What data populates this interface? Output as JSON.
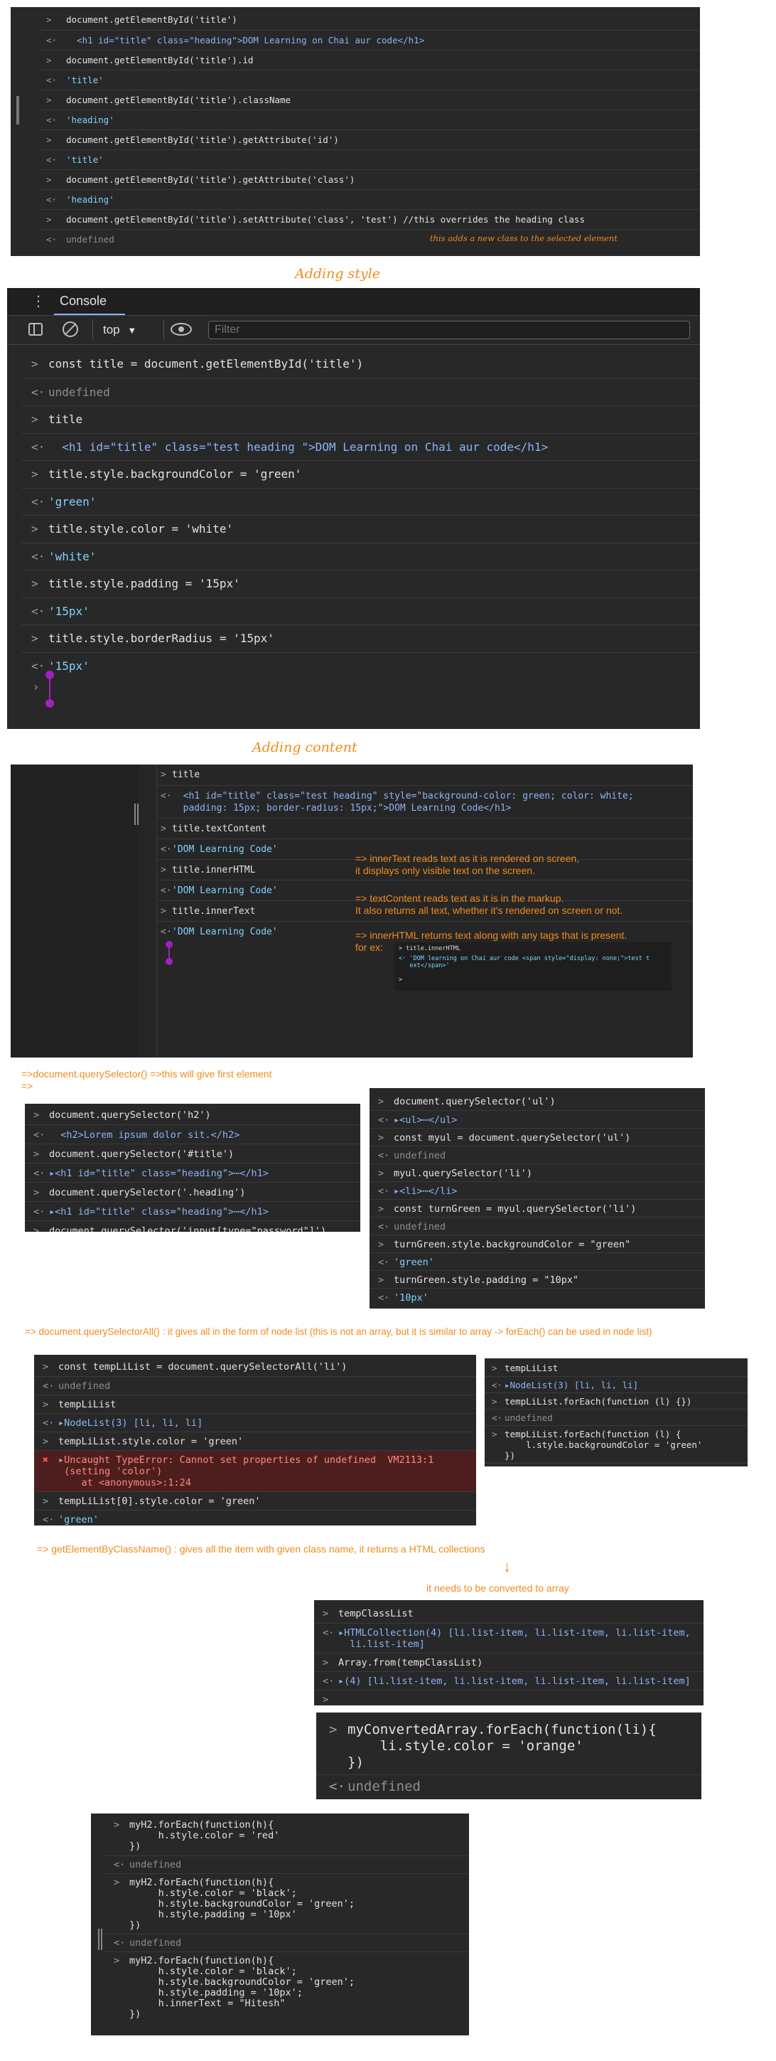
{
  "panel1": {
    "rows": [
      {
        "pr": ">",
        "code": "document.getElementById('title')"
      },
      {
        "pr": "<·",
        "code": "  <h1 id=\"title\" class=\"heading\">DOM Learning on Chai aur code</h1>"
      },
      {
        "pr": ">",
        "code": "document.getElementById('title').id"
      },
      {
        "pr": "<·",
        "code": "'title'"
      },
      {
        "pr": ">",
        "code": "document.getElementById('title').className"
      },
      {
        "pr": "<·",
        "code": "'heading'"
      },
      {
        "pr": ">",
        "code": "document.getElementById('title').getAttribute('id')"
      },
      {
        "pr": "<·",
        "code": "'title'"
      },
      {
        "pr": ">",
        "code": "document.getElementById('title').getAttribute('class')"
      },
      {
        "pr": "<·",
        "code": "'heading'"
      },
      {
        "pr": ">",
        "code": "document.getElementById('title').setAttribute('class', 'test') //this overrides the heading class"
      },
      {
        "pr": "<·",
        "code": "undefined"
      }
    ],
    "annotation": "this adds a new class to the selected element"
  },
  "heading_adding_style": "Adding style",
  "console": {
    "tab_label": "Console",
    "context": "top",
    "filter_placeholder": "Filter",
    "rows": [
      {
        "pr": ">",
        "code": "const title = document.getElementById('title')"
      },
      {
        "pr": "<·",
        "code": "undefined"
      },
      {
        "pr": ">",
        "code": "title"
      },
      {
        "pr": "<·",
        "code": "  <h1 id=\"title\" class=\"test heading \">DOM Learning on Chai aur code</h1>"
      },
      {
        "pr": ">",
        "code": "title.style.backgroundColor = 'green'"
      },
      {
        "pr": "<·",
        "code": "'green'"
      },
      {
        "pr": ">",
        "code": "title.style.color = 'white'"
      },
      {
        "pr": "<·",
        "code": "'white'"
      },
      {
        "pr": ">",
        "code": "title.style.padding = '15px'"
      },
      {
        "pr": "<·",
        "code": "'15px'"
      },
      {
        "pr": ">",
        "code": "title.style.borderRadius = '15px'"
      },
      {
        "pr": "<·",
        "code": "'15px'"
      }
    ]
  },
  "heading_adding_content": "Adding content",
  "panel3": {
    "rows": [
      {
        "pr": ">",
        "code": "title"
      },
      {
        "pr": "<·",
        "code": "  <h1 id=\"title\" class=\"test heading\" style=\"background-color: green; color: white;\n  padding: 15px; border-radius: 15px;\">DOM Learning Code</h1>"
      },
      {
        "pr": ">",
        "code": "title.textContent"
      },
      {
        "pr": "<·",
        "code": "'DOM Learning Code'"
      },
      {
        "pr": ">",
        "code": "title.innerHTML"
      },
      {
        "pr": "<·",
        "code": "'DOM Learning Code'"
      },
      {
        "pr": ">",
        "code": "title.innerText"
      },
      {
        "pr": "<·",
        "code": "'DOM Learning Code'"
      }
    ],
    "notes": [
      "=> innerText reads text as it is rendered on screen,\nit displays only visible text on the screen.",
      "=> textContent reads text as it is in the markup.\nIt also returns all text, whether it's rendered on screen or not.",
      "=> innerHTML returns text along with any tags that is present.\nfor ex:"
    ],
    "mini": [
      "> title.innerHTML",
      "<· 'DOM learning on Chai aur code <span style=\"display: none;\">test t\n   ext</span>'",
      ">"
    ]
  },
  "qs_note": "=>document.querySelector() =>this will give first element\n=>",
  "panel4": {
    "rows": [
      {
        "pr": ">",
        "code": "document.querySelector('h2')"
      },
      {
        "pr": "<·",
        "code": "  <h2>Lorem ipsum dolor sit.</h2>"
      },
      {
        "pr": ">",
        "code": "document.querySelector('#title')"
      },
      {
        "pr": "<·",
        "code": "▸<h1 id=\"title\" class=\"heading\">⋯</h1>"
      },
      {
        "pr": ">",
        "code": "document.querySelector('.heading')"
      },
      {
        "pr": "<·",
        "code": "▸<h1 id=\"title\" class=\"heading\">⋯</h1>"
      },
      {
        "pr": ">",
        "code": "document.querySelector('input[type=\"password\"]')"
      }
    ]
  },
  "panel5": {
    "rows": [
      {
        "pr": ">",
        "code": "document.querySelector('ul')"
      },
      {
        "pr": "<·",
        "code": "▸<ul>⋯</ul>"
      },
      {
        "pr": ">",
        "code": "const myul = document.querySelector('ul')"
      },
      {
        "pr": "<·",
        "code": "undefined"
      },
      {
        "pr": ">",
        "code": "myul.querySelector('li')"
      },
      {
        "pr": "<·",
        "code": "▸<li>⋯</li>"
      },
      {
        "pr": ">",
        "code": "const turnGreen = myul.querySelector('li')"
      },
      {
        "pr": "<·",
        "code": "undefined"
      },
      {
        "pr": ">",
        "code": "turnGreen.style.backgroundColor = \"green\""
      },
      {
        "pr": "<·",
        "code": "'green'"
      },
      {
        "pr": ">",
        "code": "turnGreen.style.padding = \"10px\""
      },
      {
        "pr": "<·",
        "code": "'10px'"
      }
    ]
  },
  "qsa_note": "=> document.querySelectorAll() : it gives all in the form of node list (this is not an array, but it is similar to array -> forEach() can be used in node list)",
  "panel6": {
    "rows": [
      {
        "pr": ">",
        "code": "const tempLiList = document.querySelectorAll('li')"
      },
      {
        "pr": "<·",
        "code": "undefined"
      },
      {
        "pr": ">",
        "code": "tempLiList"
      },
      {
        "pr": "<·",
        "code": "▸NodeList(3) [li, li, li]"
      },
      {
        "pr": ">",
        "code": "tempLiList.style.color = 'green'"
      },
      {
        "pr": "✖",
        "code": "▸Uncaught TypeError: Cannot set properties of undefined  VM2113:1\n (setting 'color')\n    at <anonymous>:1:24"
      },
      {
        "pr": ">",
        "code": "tempLiList[0].style.color = 'green'"
      },
      {
        "pr": "<·",
        "code": "'green'"
      }
    ]
  },
  "panel7": {
    "rows": [
      {
        "pr": ">",
        "code": "tempLiList"
      },
      {
        "pr": "<·",
        "code": "▸NodeList(3) [li, li, li]"
      },
      {
        "pr": ">",
        "code": "tempLiList.forEach(function (l) {})"
      },
      {
        "pr": "<·",
        "code": "undefined"
      },
      {
        "pr": ">",
        "code": "tempLiList.forEach(function (l) {\n    l.style.backgroundColor = 'green'\n})"
      },
      {
        "pr": "<·",
        "code": "undefined"
      }
    ]
  },
  "gc_note": "=> getElementByClassName() : gives all the item with given class name, it returns a HTML collections",
  "gc_arrow": "↓",
  "gc_note2": "it needs to be converted to array",
  "panel8": {
    "rows": [
      {
        "pr": ">",
        "code": "tempClassList"
      },
      {
        "pr": "<·",
        "code": "▸HTMLCollection(4) [li.list-item, li.list-item, li.list-item,\n  li.list-item]"
      },
      {
        "pr": ">",
        "code": "Array.from(tempClassList)"
      },
      {
        "pr": "<·",
        "code": "▸(4) [li.list-item, li.list-item, li.list-item, li.list-item]"
      },
      {
        "pr": ">",
        "code": ""
      }
    ]
  },
  "panel9": {
    "rows": [
      {
        "pr": ">",
        "code": "myConvertedArray.forEach(function(li){\n    li.style.color = 'orange'\n})"
      },
      {
        "pr": "<·",
        "code": "undefined"
      }
    ]
  },
  "panel10": {
    "rows": [
      {
        "pr": ">",
        "code": "myH2.forEach(function(h){\n     h.style.color = 'red'\n})"
      },
      {
        "pr": "<·",
        "code": "undefined"
      },
      {
        "pr": ">",
        "code": "myH2.forEach(function(h){\n     h.style.color = 'black';\n     h.style.backgroundColor = 'green';\n     h.style.padding = '10px'\n})"
      },
      {
        "pr": "<·",
        "code": "undefined"
      },
      {
        "pr": ">",
        "code": "myH2.forEach(function(h){\n     h.style.color = 'black';\n     h.style.backgroundColor = 'green';\n     h.style.padding = '10px';\n     h.innerText = \"Hitesh\"\n})"
      }
    ]
  }
}
